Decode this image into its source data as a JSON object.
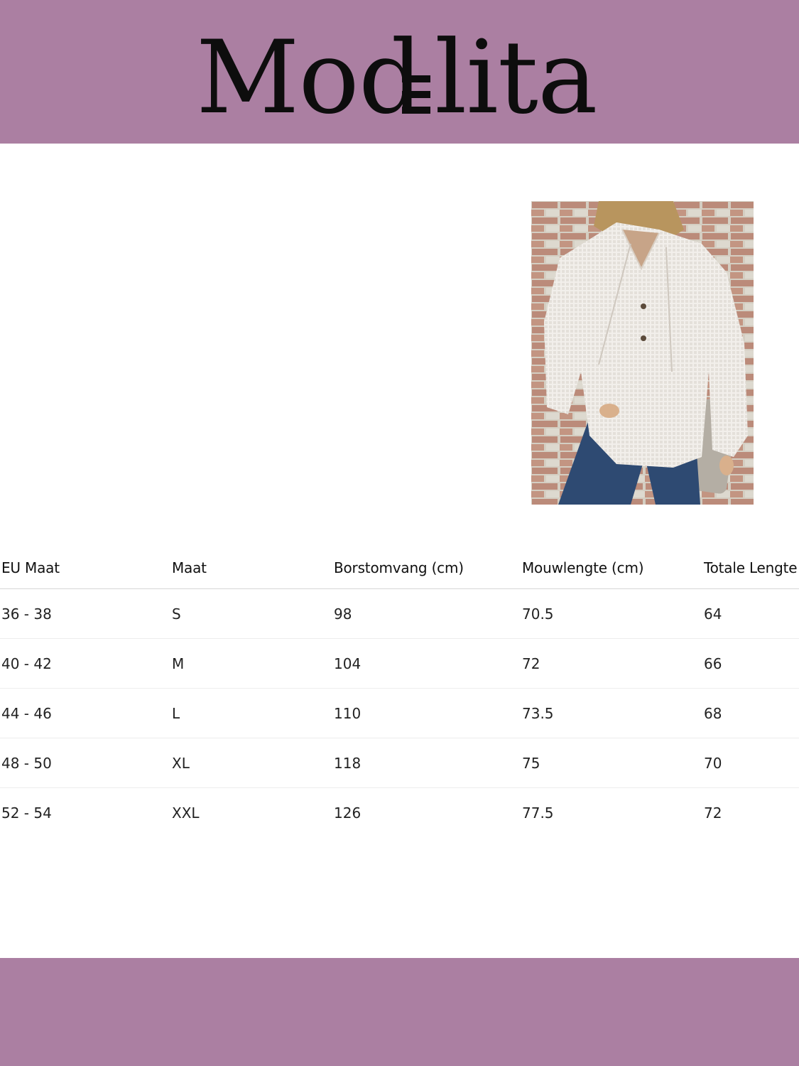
{
  "brand": {
    "logo_text": "Mod≡lita",
    "header_color": "#ab7fa2",
    "footer_color": "#ab7fa2"
  },
  "product_image": {
    "icon": "product-photo-white-waffle-knit-hoodie"
  },
  "size_table": {
    "headers": [
      "EU Maat",
      "Maat",
      "Borstomvang (cm)",
      "Mouwlengte (cm)",
      "Totale Lengte"
    ],
    "rows": [
      [
        "36 - 38",
        "S",
        "98",
        "70.5",
        "64"
      ],
      [
        "40 - 42",
        "M",
        "104",
        "72",
        "66"
      ],
      [
        "44 - 46",
        "L",
        "110",
        "73.5",
        "68"
      ],
      [
        "48 - 50",
        "XL",
        "118",
        "75",
        "70"
      ],
      [
        "52 - 54",
        "XXL",
        "126",
        "77.5",
        "72"
      ]
    ]
  }
}
